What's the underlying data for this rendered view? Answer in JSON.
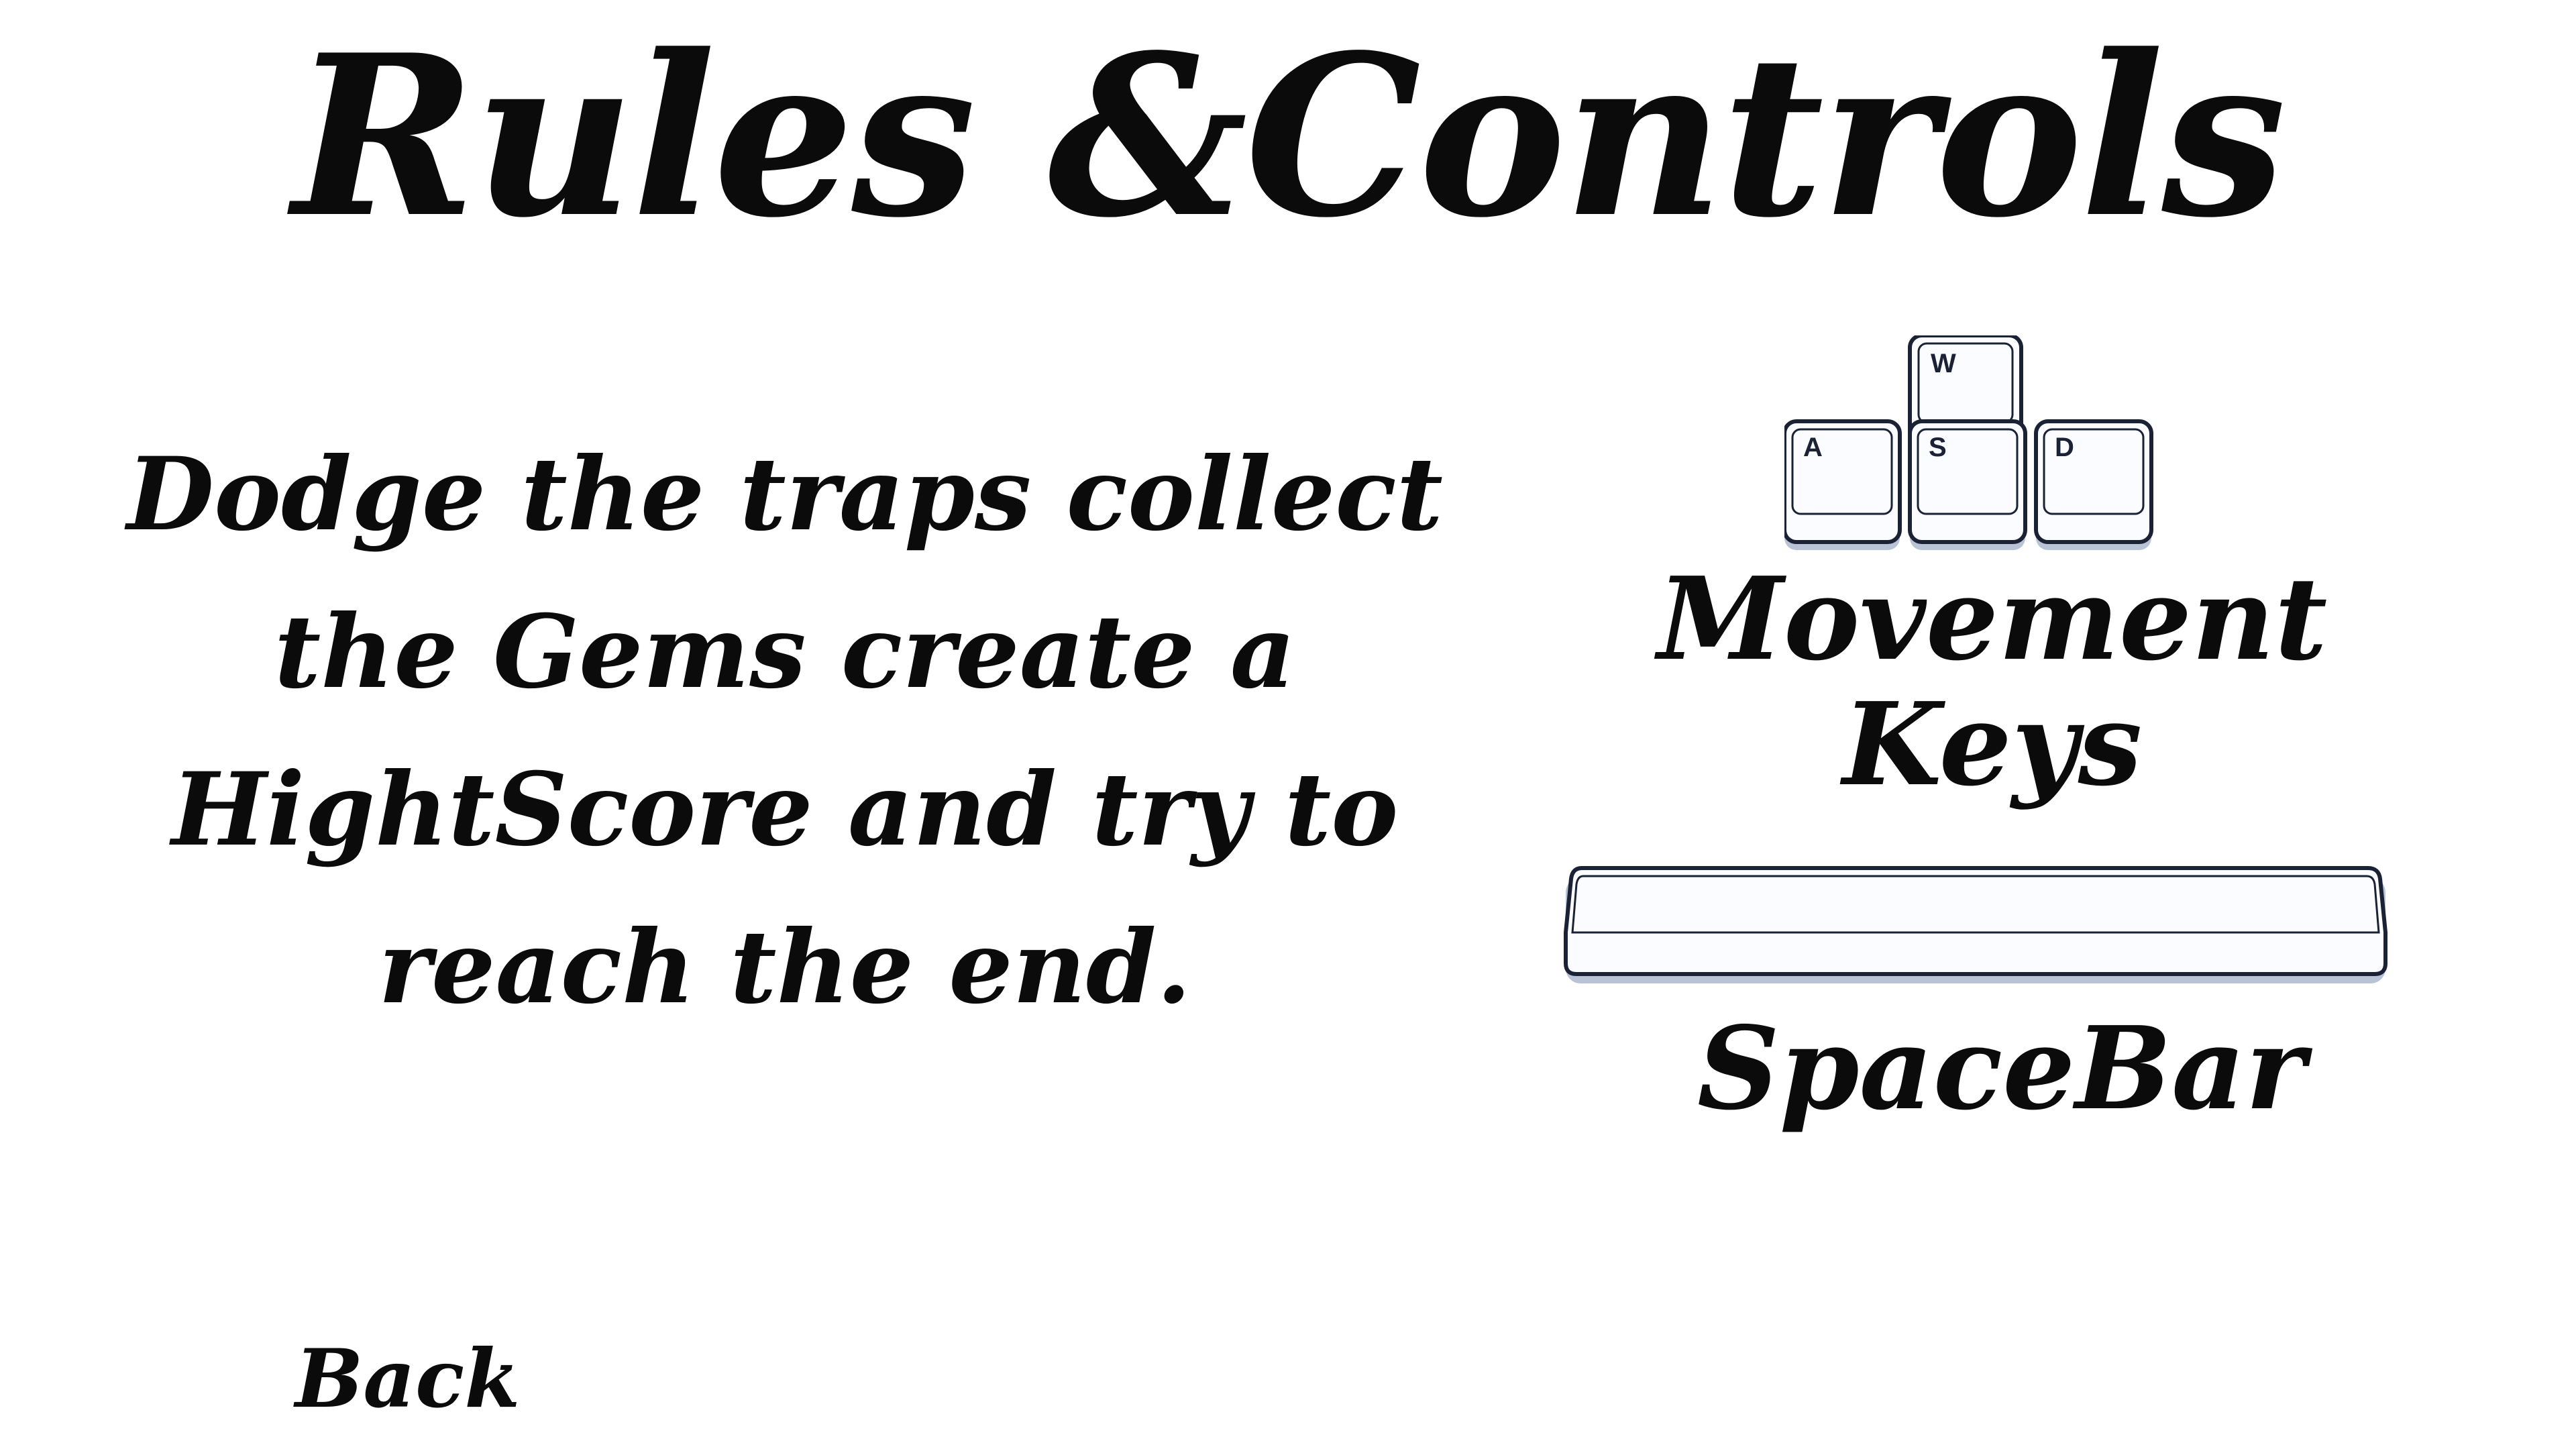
{
  "screen": {
    "title": "Rules &Controls",
    "rules_text": "Dodge the traps collect the Gems create a HightScore and try to reach the end."
  },
  "controls": {
    "movement": {
      "keys": [
        "W",
        "A",
        "S",
        "D"
      ],
      "label": "Movement Keys"
    },
    "jump": {
      "key_icon": "spacebar-key",
      "label": "SpaceBar"
    }
  },
  "navigation": {
    "back_label": "Back"
  },
  "colors": {
    "background": "#ffffff",
    "text": "#0b0b0b",
    "key_face": "#fafcff",
    "key_outline": "#1c2235",
    "key_shadow": "#b9c3d6"
  }
}
